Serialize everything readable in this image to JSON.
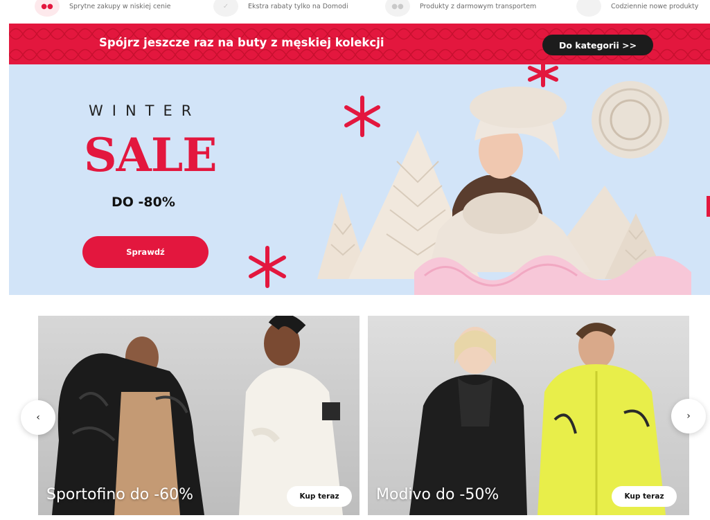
{
  "benefits": [
    {
      "icon": "piggy-icon",
      "text": "Sprytne zakupy w niskiej cenie"
    },
    {
      "icon": "discount-icon",
      "text": "Ekstra rabaty tylko na Domodi"
    },
    {
      "icon": "delivery-icon",
      "text": "Produkty z darmowym transportem"
    },
    {
      "icon": "new-icon",
      "text": "Codziennie nowe produkty"
    }
  ],
  "promo": {
    "text": "Spójrz jeszcze raz na buty z męskiej kolekcji",
    "button": "Do kategorii >>"
  },
  "hero": {
    "kicker": "WINTER",
    "headline": "SALE",
    "discount": "DO -80%",
    "cta": "Sprawdź"
  },
  "cards": [
    {
      "title": "Sportofino do -60%",
      "button": "Kup teraz"
    },
    {
      "title": "Modivo do -50%",
      "button": "Kup teraz"
    }
  ],
  "carousel": {
    "prev": "‹",
    "next": "›"
  },
  "colors": {
    "accent": "#e3173e",
    "hero_bg": "#d2e4f8",
    "dark_button": "#1c1c1c"
  }
}
